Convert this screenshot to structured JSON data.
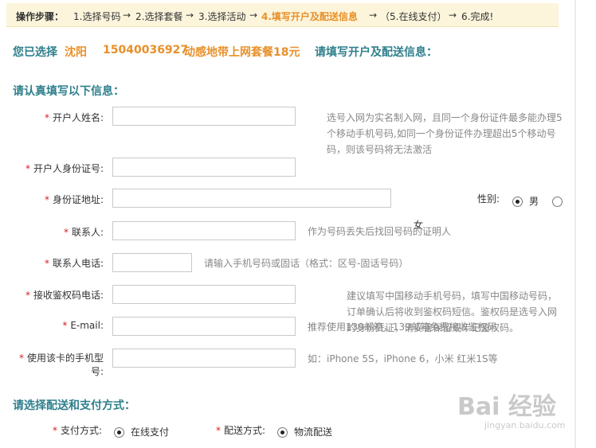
{
  "steps": {
    "lead": "操作步骤：",
    "items": [
      "1.选择号码",
      "2.选择套餐",
      "3.选择活动",
      "4.填写开户及配送信息",
      "（5.在线支付）",
      "6.完成!"
    ],
    "arrow": "→"
  },
  "chosen": {
    "prefix": "您已选择",
    "city": "沈阳",
    "number": "15040036927",
    "plan": "动感地带上网套餐18元",
    "suffix": "请填写开户及配送信息："
  },
  "form_title": "请认真填写以下信息：",
  "required_mark": "*",
  "fields": {
    "name_label": "开户人姓名:",
    "name_hint": "选号入网为实名制入网，且同一个身份证件最多能办理5个移动手机号码,如同一个身份证件办理超出5个移动号码，则该号码将无法激活",
    "id_label": "开户人身份证号:",
    "address_label": "身份证地址:",
    "gender_label": "性别:",
    "gender_male": "男",
    "gender_female": "女",
    "contact_label": "联系人:",
    "contact_hint": "作为号码丢失后找回号码的证明人",
    "phone_label": "联系人电话:",
    "phone_hint": "请输入手机号码或固话（格式：区号-固话号码）",
    "auth_label": "接收鉴权码电话:",
    "auth_hint": "建议填写中国移动手机号码，填写中国移动号码，订单确认后将收到鉴权码短信。鉴权码是选号入网的身份凭证，请妥善保留或牢记鉴权码。",
    "email_label": "E-mail:",
    "email_hint": "推荐使用139邮箱，139邮箱免费接收鉴权码",
    "model_label_line1": "使用该卡的手机型",
    "model_label_line2": "号:",
    "model_hint": "如：iPhone 5S，iPhone 6，小米 红米1S等"
  },
  "delivery": {
    "title": "请选择配送和支付方式：",
    "pay_label": "支付方式:",
    "pay_option": "在线支付",
    "ship_label": "配送方式:",
    "ship_option": "物流配送"
  },
  "watermark": {
    "brand": "Bai 经验",
    "url": "jingyan.baidu.com"
  }
}
